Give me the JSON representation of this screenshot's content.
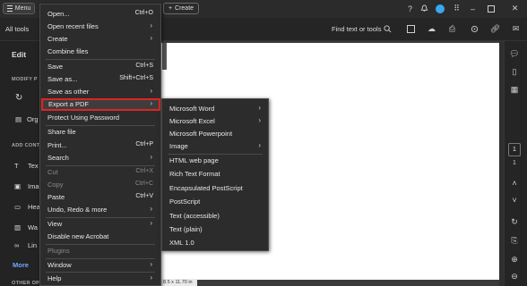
{
  "titlebar": {
    "menu_label": "Menu",
    "create_label": "Create",
    "icons": [
      "help-icon",
      "bell-icon",
      "apps-grid-icon",
      "avatar",
      "minimize-icon",
      "maximize-icon",
      "close-icon"
    ]
  },
  "toolbar": {
    "all_tools": "All tools",
    "find_placeholder": "Find text or tools"
  },
  "left_panel": {
    "edit": "Edit",
    "modify_heading": "MODIFY P",
    "org_label": "Org",
    "add_heading": "ADD CONT",
    "items": [
      "Tex",
      "Ima",
      "Hea",
      "Wa",
      "Lin"
    ],
    "more": "More",
    "other_heading": "OTHER OP"
  },
  "main_menu": {
    "items": [
      {
        "label": "Open...",
        "shortcut": "Ctrl+O"
      },
      {
        "label": "Open recent files",
        "arrow": "›"
      },
      {
        "label": "Create",
        "arrow": "›"
      },
      {
        "label": "Combine files"
      },
      {
        "label": "Save",
        "shortcut": "Ctrl+S"
      },
      {
        "label": "Save as...",
        "shortcut": "Shift+Ctrl+S"
      },
      {
        "label": "Save as other",
        "arrow": "›"
      },
      {
        "label": "Export a PDF",
        "arrow": "›"
      },
      {
        "label": "Protect Using Password"
      },
      {
        "label": "Share file"
      },
      {
        "label": "Print...",
        "shortcut": "Ctrl+P"
      },
      {
        "label": "Search",
        "arrow": "›"
      },
      {
        "label": "Cut",
        "shortcut": "Ctrl+X"
      },
      {
        "label": "Copy",
        "shortcut": "Ctrl+C"
      },
      {
        "label": "Paste",
        "shortcut": "Ctrl+V"
      },
      {
        "label": "Undo, Redo & more",
        "arrow": "›"
      },
      {
        "label": "View",
        "arrow": "›"
      },
      {
        "label": "Disable new Acrobat"
      },
      {
        "label": "Plugins"
      },
      {
        "label": "Window",
        "arrow": "›"
      },
      {
        "label": "Help",
        "arrow": "›"
      }
    ]
  },
  "export_submenu": {
    "items": [
      {
        "label": "Microsoft Word",
        "arrow": "›"
      },
      {
        "label": "Microsoft Excel",
        "arrow": "›"
      },
      {
        "label": "Microsoft Powerpoint"
      },
      {
        "label": "Image",
        "arrow": "›"
      },
      {
        "label": "HTML web page"
      },
      {
        "label": "Rich Text Format"
      },
      {
        "label": "Encapsulated PostScript"
      },
      {
        "label": "PostScript"
      },
      {
        "label": "Text (accessible)"
      },
      {
        "label": "Text (plain)"
      },
      {
        "label": "XML 1.0"
      }
    ]
  },
  "document": {
    "page_size": "8.5 x 11.70 in",
    "current_page": "1",
    "total_pages": "1"
  },
  "colors": {
    "highlight_border": "#e02424",
    "avatar": "#39a8f0"
  }
}
